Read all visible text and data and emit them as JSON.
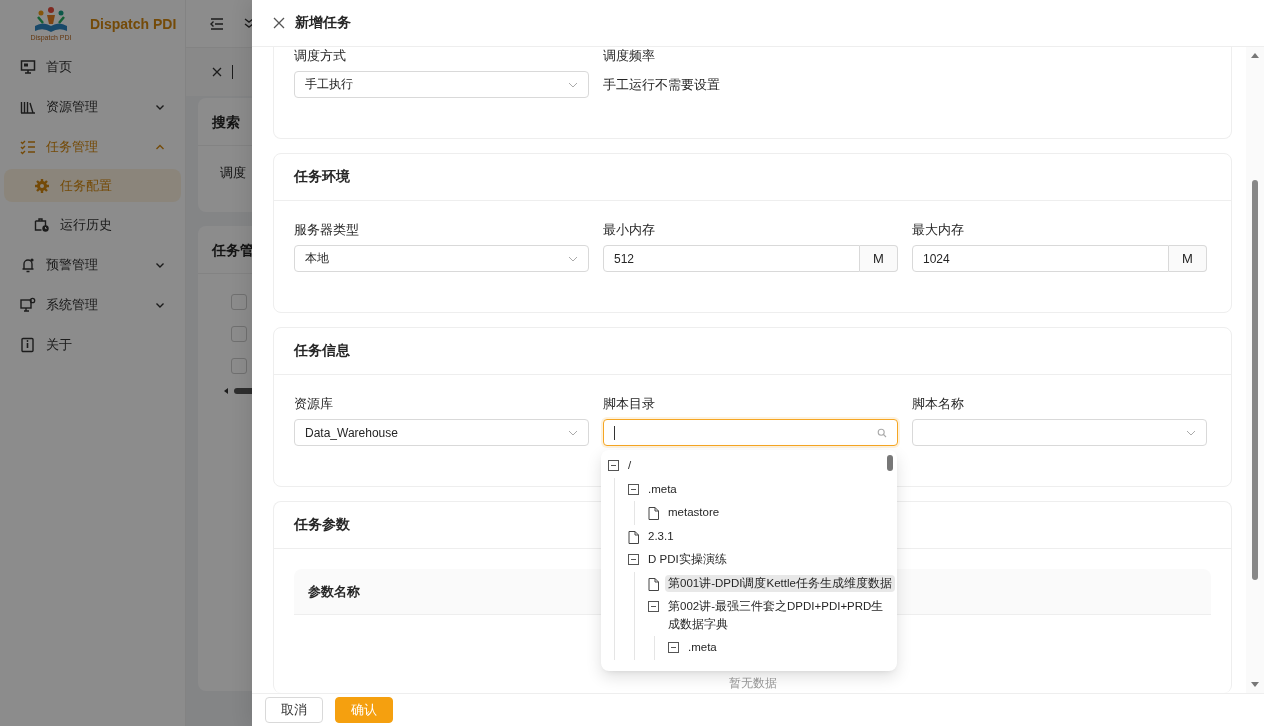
{
  "sidebar": {
    "logo_caption": "Dispatch PDI",
    "brand": "Dispatch PDI",
    "items": [
      {
        "label": "首页",
        "selected": false
      },
      {
        "label": "资源管理",
        "selected": false,
        "expanded": false
      },
      {
        "label": "任务管理",
        "selected": true,
        "expanded": true,
        "children": [
          {
            "label": "任务配置",
            "selected": true
          },
          {
            "label": "运行历史",
            "selected": false
          }
        ]
      },
      {
        "label": "预警管理",
        "selected": false,
        "expanded": false
      },
      {
        "label": "系统管理",
        "selected": false,
        "expanded": false
      },
      {
        "label": "关于",
        "selected": false
      }
    ]
  },
  "background": {
    "search_card": {
      "title": "搜索",
      "field_label": "调度"
    },
    "task_card": {
      "title": "任务管",
      "checkboxes": [
        {
          "checked": false
        },
        {
          "checked": false
        },
        {
          "checked": false
        }
      ]
    }
  },
  "drawer": {
    "title": "新增任务",
    "sections": [
      {
        "fields": [
          {
            "kind": "select",
            "label": "调度方式",
            "value": "手工执行"
          },
          {
            "kind": "text",
            "label": "调度频率",
            "value": "手工运行不需要设置"
          }
        ]
      },
      {
        "title": "任务环境",
        "fields": [
          {
            "kind": "select",
            "label": "服务器类型",
            "value": "本地"
          },
          {
            "kind": "suffix_input",
            "label": "最小内存",
            "value": "512",
            "suffix": "M"
          },
          {
            "kind": "suffix_input",
            "label": "最大内存",
            "value": "1024",
            "suffix": "M"
          }
        ]
      },
      {
        "title": "任务信息",
        "fields": [
          {
            "kind": "select",
            "label": "资源库",
            "value": "Data_Warehouse"
          },
          {
            "kind": "tree_select",
            "label": "脚本目录",
            "focused": true
          },
          {
            "kind": "select",
            "label": "脚本名称"
          }
        ]
      },
      {
        "title": "任务参数",
        "table": {
          "columns": [
            "参数名称"
          ],
          "empty_text": "暂无数据"
        }
      }
    ],
    "script_tree": [
      {
        "label": "/",
        "kind": "folder",
        "expanded": true,
        "selected": false,
        "children": [
          {
            "label": ".meta",
            "kind": "folder",
            "expanded": true,
            "selected": false,
            "children": [
              {
                "label": "metastore",
                "kind": "file",
                "selected": false
              }
            ]
          },
          {
            "label": "2.3.1",
            "kind": "file",
            "selected": false
          },
          {
            "label": "D PDI实操演练",
            "kind": "folder",
            "expanded": true,
            "selected": false,
            "children": [
              {
                "label": "第001讲-DPDI调度Kettle任务生成维度数据",
                "kind": "file",
                "selected": true
              },
              {
                "label": "第002讲-最强三件套之DPDI+PDI+PRD生成数据字典",
                "kind": "folder",
                "expanded": true,
                "selected": false,
                "children": [
                  {
                    "label": ".meta",
                    "kind": "folder",
                    "expanded": true,
                    "selected": false
                  }
                ]
              }
            ]
          }
        ]
      }
    ],
    "buttons": [
      {
        "label": "取消",
        "kind": "default"
      },
      {
        "label": "确认",
        "kind": "primary"
      }
    ]
  }
}
